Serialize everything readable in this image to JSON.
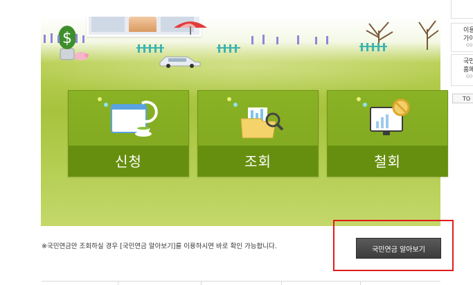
{
  "cards": [
    {
      "label": "신청",
      "icon": "browser-window-tea-icon"
    },
    {
      "label": "조회",
      "icon": "folder-magnifier-icon"
    },
    {
      "label": "철회",
      "icon": "monitor-no-sign-icon"
    }
  ],
  "notice": "※국민연금만 조회하실 경우 [국민연금 알아보기]를 이용하시면 바로 확인 가능합니다.",
  "pension_button": "국민연금 알아보기",
  "sidebar": {
    "items": [
      {
        "title_1": "이용",
        "title_2": "가이",
        "sub": "GO"
      },
      {
        "title_1": "국민",
        "title_2": "홈페",
        "sub": "GO"
      }
    ],
    "top_label": "TO"
  },
  "colors": {
    "card": "#7fa61e",
    "card_lower": "#678f0f",
    "highlight": "#e11b1b",
    "button": "#444444"
  }
}
